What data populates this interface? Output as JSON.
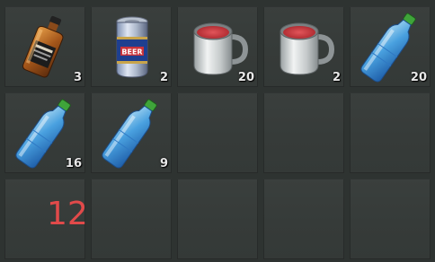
{
  "inventory": {
    "page_number": "12",
    "slots": [
      {
        "item": "whiskey-bottle",
        "count": "3"
      },
      {
        "item": "beer-can",
        "count": "2",
        "label": "BEER"
      },
      {
        "item": "metal-mug-red",
        "count": "20"
      },
      {
        "item": "metal-mug-red",
        "count": "2"
      },
      {
        "item": "water-bottle",
        "count": "20"
      },
      {
        "item": "water-bottle",
        "count": "16"
      },
      {
        "item": "water-bottle",
        "count": "9"
      },
      {
        "item": "empty",
        "count": ""
      },
      {
        "item": "empty",
        "count": ""
      },
      {
        "item": "empty",
        "count": ""
      },
      {
        "item": "empty",
        "count": ""
      },
      {
        "item": "empty",
        "count": ""
      },
      {
        "item": "empty",
        "count": ""
      },
      {
        "item": "empty",
        "count": ""
      },
      {
        "item": "empty",
        "count": ""
      }
    ]
  },
  "colors": {
    "background": "#2e3331",
    "slot": "#383d3b",
    "count_text": "#e8e8e8",
    "page_number": "#e14a4a",
    "bottle_cap": "#3fa43a",
    "mug_liquid": "#c8343a"
  }
}
